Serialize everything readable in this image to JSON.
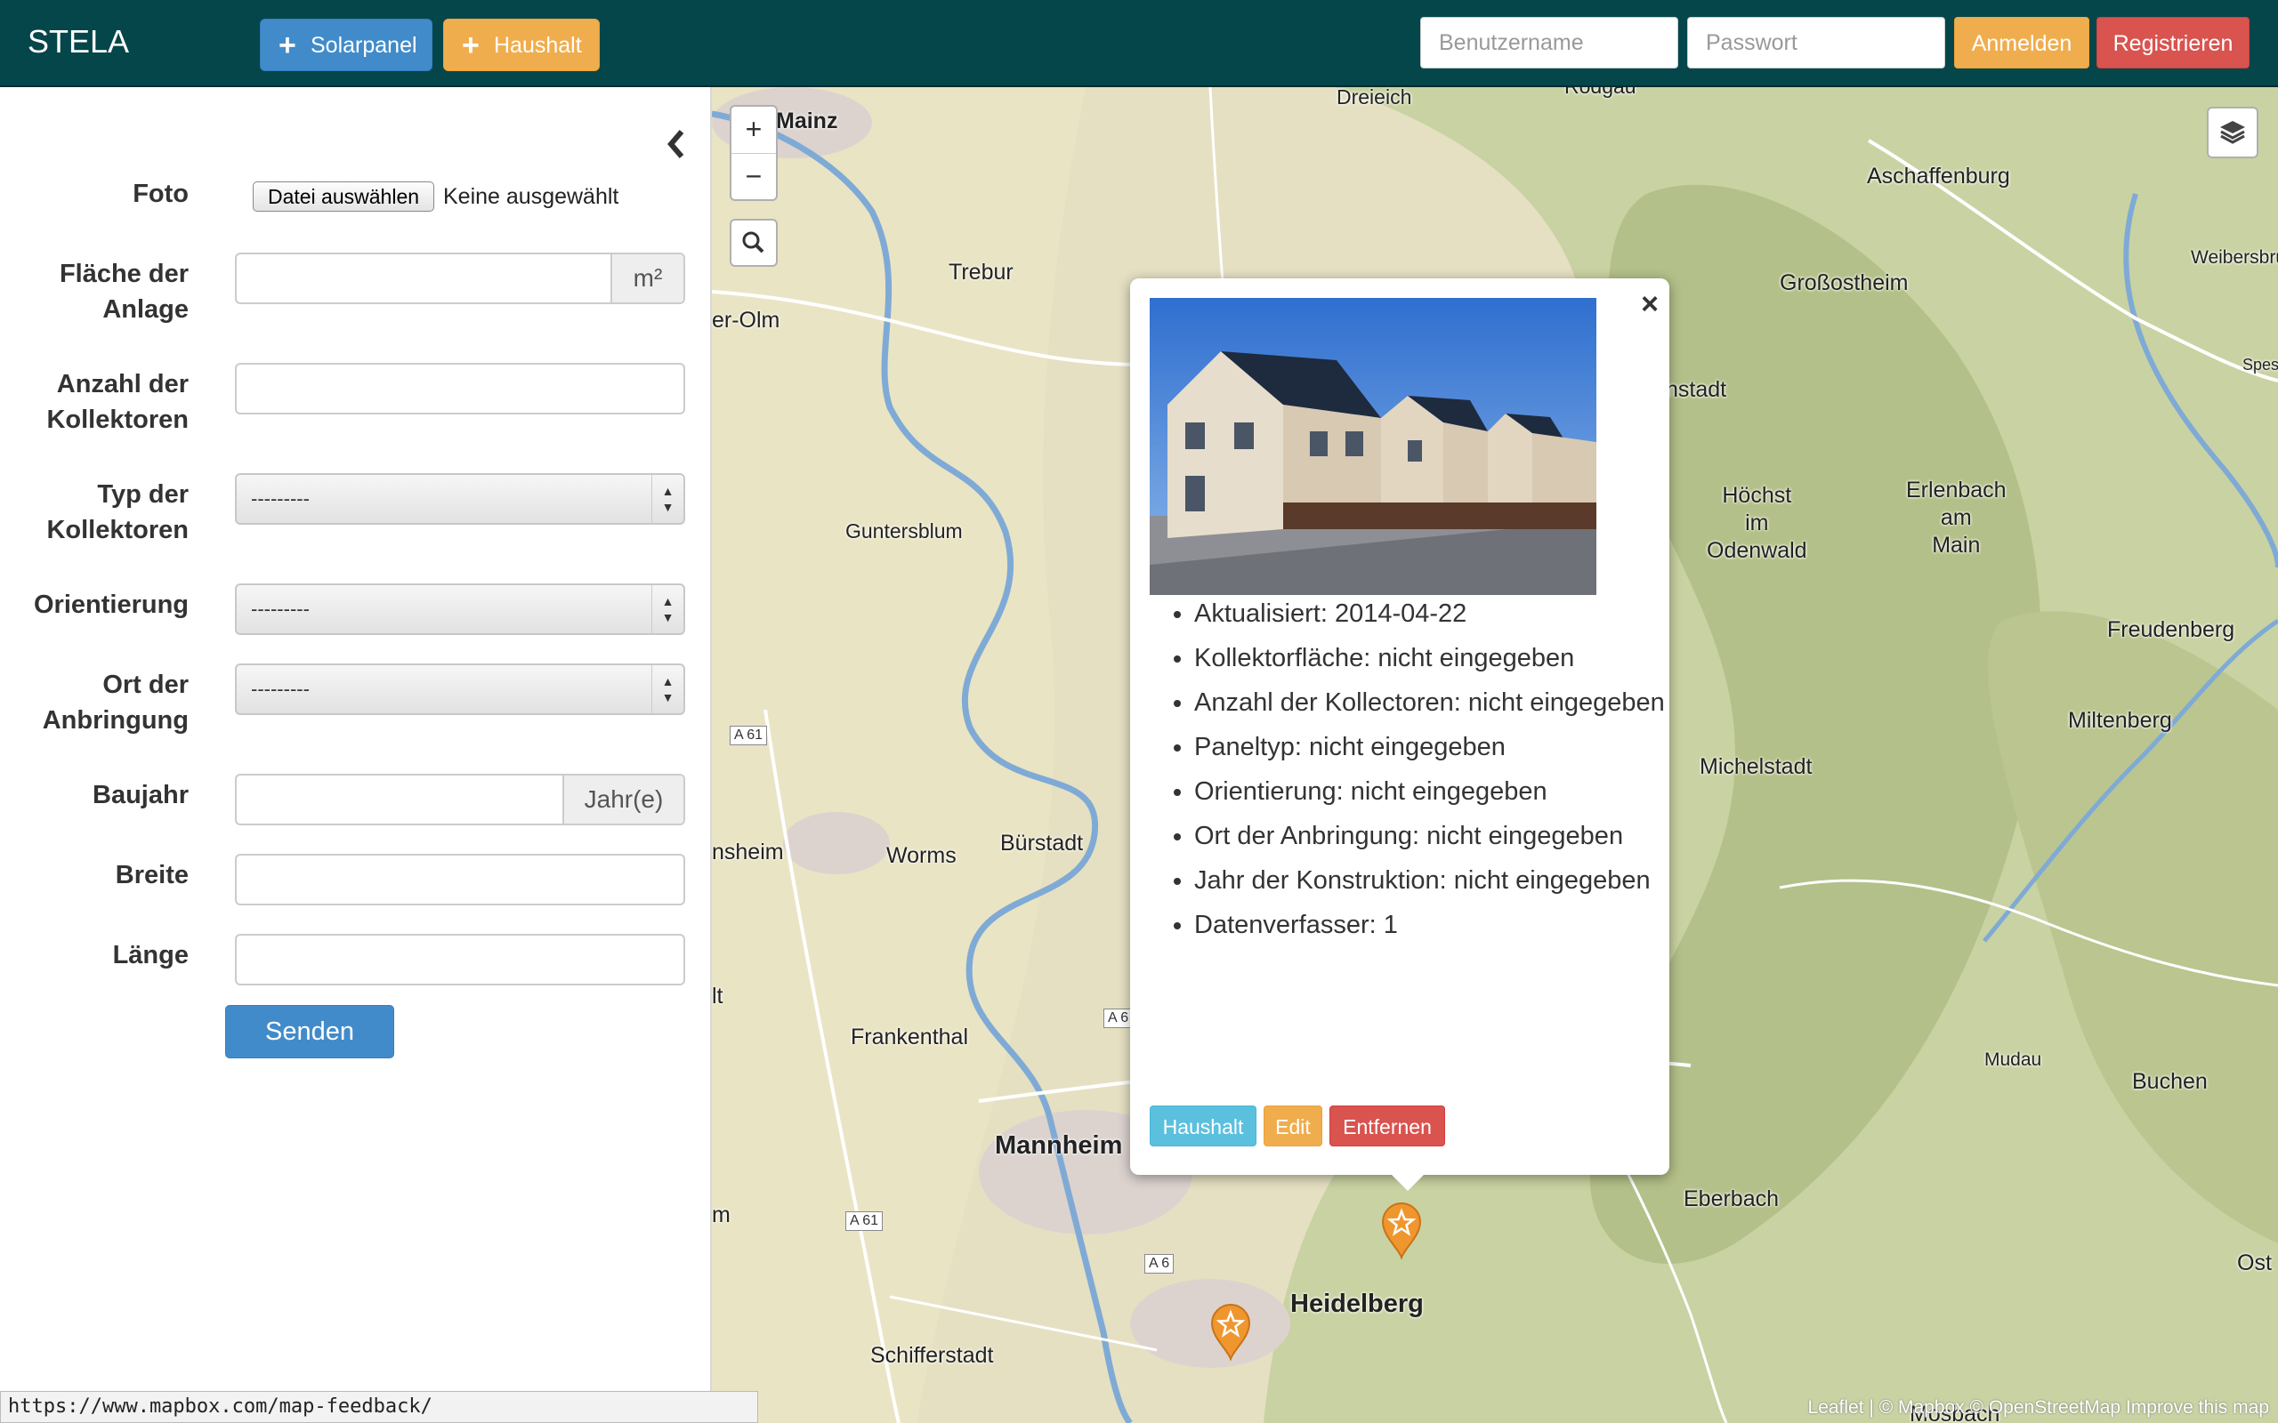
{
  "navbar": {
    "brand": "STELA",
    "add_solarpanel_label": "Solarpanel",
    "add_household_label": "Haushalt",
    "username_placeholder": "Benutzername",
    "password_placeholder": "Passwort",
    "login_label": "Anmelden",
    "register_label": "Registrieren"
  },
  "form": {
    "photo_label": "Foto",
    "file_button_label": "Datei auswählen",
    "file_status": "Keine ausgewählt",
    "area_label_1": "Fläche der",
    "area_label_2": "Anlage",
    "area_unit": "m²",
    "collector_count_label_1": "Anzahl der",
    "collector_count_label_2": "Kollektoren",
    "collector_type_label_1": "Typ der",
    "collector_type_label_2": "Kollektoren",
    "collector_type_value": "---------",
    "orientation_label": "Orientierung",
    "orientation_value": "---------",
    "mount_label_1": "Ort der",
    "mount_label_2": "Anbringung",
    "mount_value": "---------",
    "year_label": "Baujahr",
    "year_unit": "Jahr(e)",
    "latitude_label": "Breite",
    "longitude_label": "Länge",
    "submit_label": "Senden"
  },
  "status_url": "https://www.mapbox.com/map-feedback/",
  "map": {
    "zoom_in": "+",
    "zoom_out": "−",
    "places": {
      "mainz": "Mainz",
      "dreieich": "Dreieich",
      "rodgau": "Rodgau",
      "aschaffenburg": "Aschaffenburg",
      "weibersbrunn": "Weibersbrunn",
      "spessart": "Spessart",
      "trebur": "Trebur",
      "erolm": "er-Olm",
      "grossostheim": "Großostheim",
      "darmstadt": "nstadt",
      "hoechst_1": "Höchst",
      "hoechst_2": "im",
      "hoechst_3": "Odenwald",
      "erlenbach_1": "Erlenbach",
      "erlenbach_2": "am",
      "erlenbach_3": "Main",
      "guntersblum": "Guntersblum",
      "freudenberg": "Freudenberg",
      "miltenberg": "Miltenberg",
      "michelstadt": "Michelstadt",
      "worms": "Worms",
      "buerstadt": "Bürstadt",
      "nsheim": "nsheim",
      "lt": "lt",
      "frankenthal": "Frankenthal",
      "mudau": "Mudau",
      "buchen": "Buchen",
      "mannheim": "Mannheim",
      "eberbach": "Eberbach",
      "m_edge": "m",
      "heidelberg": "Heidelberg",
      "schifferstadt": "Schifferstadt",
      "ost": "Ost",
      "mosbach": "Mosbach"
    },
    "roads": {
      "a61_top": "A 61",
      "a6_mid": "A 6",
      "a61_bottom": "A 61",
      "a6_bottom": "A 6"
    },
    "attribution": "Leaflet | © Mapbox © OpenStreetMap Improve this map"
  },
  "popup": {
    "close": "×",
    "items": [
      "Aktualisiert: 2014-04-22",
      "Kollektorfläche: nicht eingegeben",
      "Anzahl der Kollectoren: nicht eingegeben",
      "Paneltyp: nicht eingegeben",
      "Orientierung: nicht eingegeben",
      "Ort der Anbringung: nicht eingegeben",
      "Jahr der Konstruktion: nicht eingegeben",
      "Datenverfasser: 1"
    ],
    "household_button": "Haushalt",
    "edit_button": "Edit",
    "remove_button": "Entfernen"
  },
  "colors": {
    "navbar_bg": "#04464a",
    "primary": "#428bca",
    "warning": "#f0ad4e",
    "danger": "#d9534f",
    "info": "#5bc0de",
    "marker": "#f0962e"
  }
}
